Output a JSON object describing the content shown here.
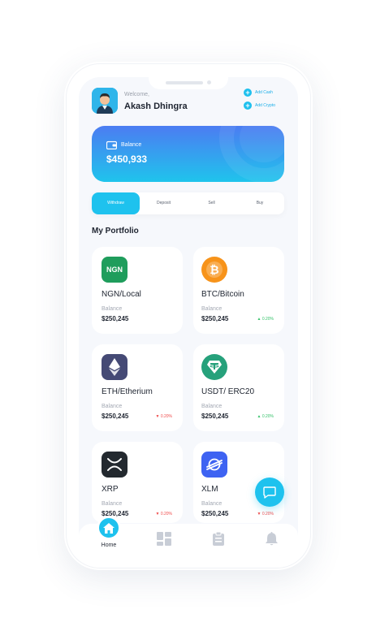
{
  "header": {
    "welcome": "Welcome,",
    "username": "Akash Dhingra",
    "add_cash": "Add Cash",
    "add_crypto": "Add Crypto"
  },
  "balance": {
    "label": "Balance",
    "value": "$450,933"
  },
  "tabs": [
    {
      "label": "Withdraw",
      "active": true
    },
    {
      "label": "Deposit",
      "active": false
    },
    {
      "label": "Sell",
      "active": false
    },
    {
      "label": "Buy",
      "active": false
    }
  ],
  "portfolio": {
    "title": "My Portfolio",
    "items": [
      {
        "name": "NGN/Local",
        "icon_text": "NGN",
        "icon_name": "ngn-icon",
        "color": "#1f9d5c",
        "balance_label": "Balance",
        "amount": "$250,245",
        "change": ""
      },
      {
        "name": "BTC/Bitcoin",
        "icon_name": "bitcoin-icon",
        "color": "#f7931a",
        "balance_label": "Balance",
        "amount": "$250,245",
        "change": "▲ 0.20%",
        "direction": "up"
      },
      {
        "name": "ETH/Etherium",
        "icon_name": "ethereum-icon",
        "color": "#454a75",
        "balance_label": "Balance",
        "amount": "$250,245",
        "change": "▼ 0.20%",
        "direction": "down"
      },
      {
        "name": "USDT/ ERC20",
        "icon_name": "tether-icon",
        "color": "#26a17b",
        "balance_label": "Balance",
        "amount": "$250,245",
        "change": "▲ 0.20%",
        "direction": "up"
      },
      {
        "name": "XRP",
        "icon_name": "xrp-icon",
        "color": "#23292f",
        "balance_label": "Balance",
        "amount": "$250,245",
        "change": "▼ 0.20%",
        "direction": "down"
      },
      {
        "name": "XLM",
        "icon_name": "stellar-icon",
        "color": "#3e63f2",
        "balance_label": "Balance",
        "amount": "$250,245",
        "change": "▼ 0.20%",
        "direction": "down"
      }
    ]
  },
  "nav": {
    "home_label": "Home"
  },
  "colors": {
    "accent": "#1ec2ee",
    "up": "#36c26a",
    "down": "#ef4a4a"
  }
}
